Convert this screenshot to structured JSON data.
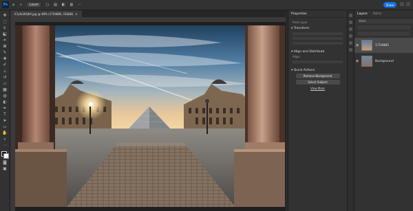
{
  "app": {
    "logo": "Ps",
    "menu": [
      "Layer"
    ],
    "share_label": "Share"
  },
  "document_tab": {
    "title": "E7pfa2KQ6A.jpg @ 48% (1754885, RGB/8)",
    "close": "×"
  },
  "properties_panel": {
    "tab": "Properties",
    "layer_type": "Pixel Layer",
    "transform_label": "Transform",
    "align_label": "Align and Distribute",
    "align_sub": "Align:",
    "quick_actions_label": "Quick Actions",
    "remove_bg_label": "Remove Background",
    "select_subject_label": "Select Subject",
    "view_more_label": "View More"
  },
  "layers_panel": {
    "tabs": [
      "Layers",
      "Paths"
    ],
    "kind_label": "Kind",
    "layers": [
      {
        "name": "1754885",
        "visible": true
      },
      {
        "name": "Background",
        "visible": true
      }
    ]
  },
  "colors": {
    "accent": "#1473e6",
    "panel_bg": "#323232",
    "canvas_bg": "#1f1f1f"
  }
}
